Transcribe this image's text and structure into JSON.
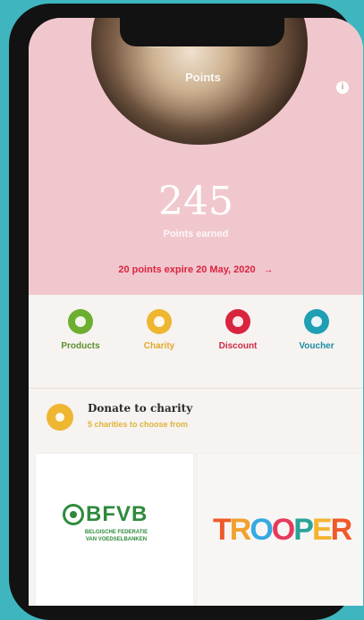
{
  "hero": {
    "caption": "Points",
    "points": "245",
    "points_label": "Points earned",
    "expire_text": "20 points expire 20 May, 2020",
    "expire_arrow": "→"
  },
  "actions": [
    {
      "label": "Products",
      "color": "#6cae2f",
      "label_color": "#5b8f2d"
    },
    {
      "label": "Charity",
      "color": "#eeb631",
      "label_color": "#e1a82a"
    },
    {
      "label": "Discount",
      "color": "#d8243e",
      "label_color": "#cf2a44"
    },
    {
      "label": "Voucher",
      "color": "#1f9fb3",
      "label_color": "#1e8da0"
    }
  ],
  "donate": {
    "title": "Donate to charity",
    "subtitle": "5 charities to choose from"
  },
  "charities": {
    "bfvb": {
      "name": "BFVB",
      "subtitle_line1": "BELGISCHE FEDERATIE",
      "subtitle_line2": "VAN VOEDSELBANKEN"
    },
    "trooper": {
      "name": "TROOPER"
    }
  },
  "icons": {
    "info": "i"
  }
}
